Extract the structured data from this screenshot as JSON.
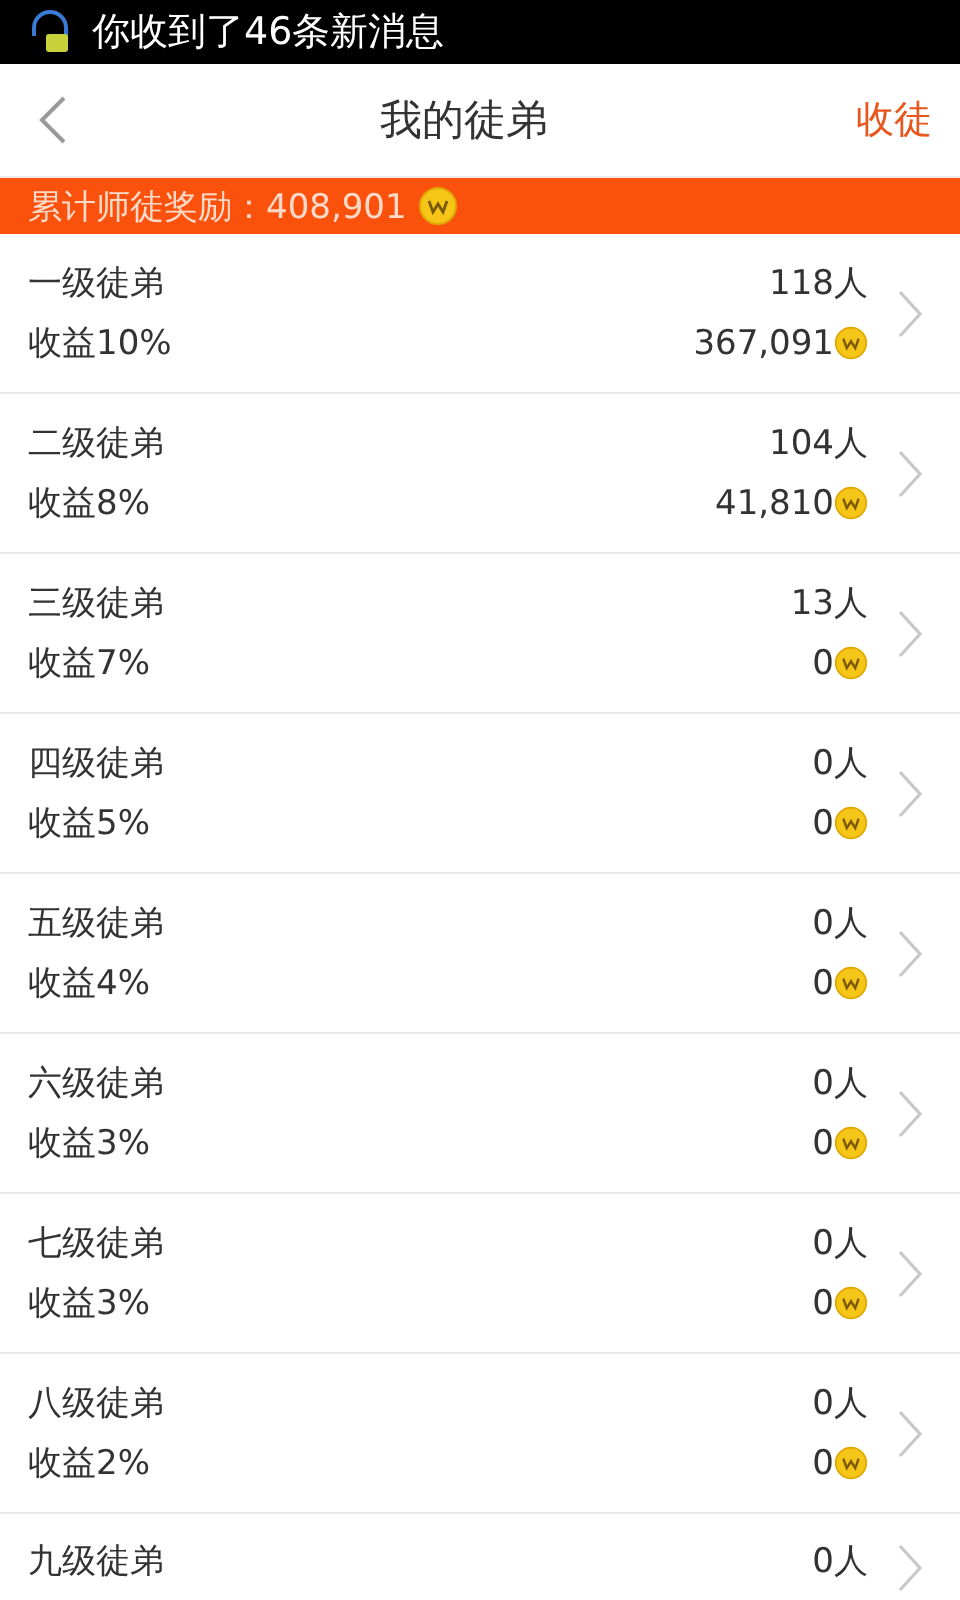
{
  "status_bar": {
    "notification": "你收到了46条新消息"
  },
  "header": {
    "title": "我的徒弟",
    "action": "收徒"
  },
  "banner": {
    "label": "累计师徒奖励：",
    "total": "408,901"
  },
  "levels": [
    {
      "name": "一级徒弟",
      "rate": "收益10%",
      "count": "118人",
      "earnings": "367,091"
    },
    {
      "name": "二级徒弟",
      "rate": "收益8%",
      "count": "104人",
      "earnings": "41,810"
    },
    {
      "name": "三级徒弟",
      "rate": "收益7%",
      "count": "13人",
      "earnings": "0"
    },
    {
      "name": "四级徒弟",
      "rate": "收益5%",
      "count": "0人",
      "earnings": "0"
    },
    {
      "name": "五级徒弟",
      "rate": "收益4%",
      "count": "0人",
      "earnings": "0"
    },
    {
      "name": "六级徒弟",
      "rate": "收益3%",
      "count": "0人",
      "earnings": "0"
    },
    {
      "name": "七级徒弟",
      "rate": "收益3%",
      "count": "0人",
      "earnings": "0"
    },
    {
      "name": "八级徒弟",
      "rate": "收益2%",
      "count": "0人",
      "earnings": "0"
    },
    {
      "name": "九级徒弟",
      "count": "0人"
    }
  ]
}
